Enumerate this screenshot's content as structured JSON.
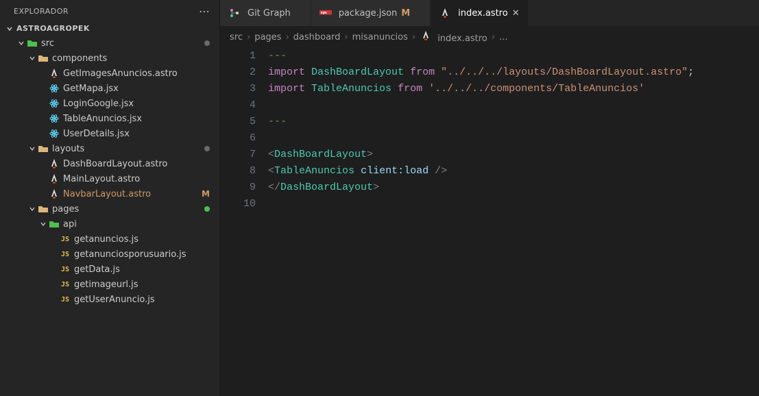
{
  "sidebar": {
    "title": "EXPLORADOR",
    "project": "ASTROAGROPEK",
    "tree": [
      {
        "d": 1,
        "chev": "down",
        "icon": "folder-green",
        "label": "src",
        "dot": "grey"
      },
      {
        "d": 2,
        "chev": "down",
        "icon": "folder",
        "label": "components"
      },
      {
        "d": 3,
        "icon": "astro",
        "label": "GetImagesAnuncios.astro"
      },
      {
        "d": 3,
        "icon": "react",
        "label": "GetMapa.jsx"
      },
      {
        "d": 3,
        "icon": "react",
        "label": "LoginGoogle.jsx"
      },
      {
        "d": 3,
        "icon": "react",
        "label": "TableAnuncios.jsx"
      },
      {
        "d": 3,
        "icon": "react",
        "label": "UserDetails.jsx"
      },
      {
        "d": 2,
        "chev": "down",
        "icon": "folder",
        "label": "layouts",
        "dot": "grey"
      },
      {
        "d": 3,
        "icon": "astro",
        "label": "DashBoardLayout.astro"
      },
      {
        "d": 3,
        "icon": "astro",
        "label": "MainLayout.astro"
      },
      {
        "d": 3,
        "icon": "astro",
        "label": "NavbarLayout.astro",
        "modified": true
      },
      {
        "d": 2,
        "chev": "down",
        "icon": "folder",
        "label": "pages",
        "dot": "green"
      },
      {
        "d": 3,
        "chev": "down",
        "icon": "folder-green",
        "label": "api"
      },
      {
        "d": 4,
        "icon": "js",
        "label": "getanuncios.js"
      },
      {
        "d": 4,
        "icon": "js",
        "label": "getanunciosporusuario.js"
      },
      {
        "d": 4,
        "icon": "js",
        "label": "getData.js"
      },
      {
        "d": 4,
        "icon": "js",
        "label": "getimageurl.js"
      },
      {
        "d": 4,
        "icon": "js",
        "label": "getUserAnuncio.js"
      }
    ]
  },
  "tabs": [
    {
      "icon": "gitgraph",
      "label": "Git Graph"
    },
    {
      "icon": "npm",
      "label": "package.json",
      "status": "M"
    },
    {
      "icon": "astro",
      "label": "index.astro",
      "active": true,
      "close": true
    }
  ],
  "breadcrumbs": [
    {
      "label": "src"
    },
    {
      "label": "pages"
    },
    {
      "label": "dashboard"
    },
    {
      "label": "misanuncios"
    },
    {
      "icon": "astro",
      "label": "index.astro"
    },
    {
      "label": "..."
    }
  ],
  "code": {
    "lines": [
      {
        "n": 1,
        "html": "<span class='fm'>---</span>"
      },
      {
        "n": 2,
        "html": "<span class='k'>import</span> <span class='t'>DashBoardLayout</span> <span class='k'>from</span> <span class='s'>\"../../../layouts/DashBoardLayout.astro\"</span>;"
      },
      {
        "n": 3,
        "html": "<span class='k'>import</span> <span class='t'>TableAnuncios</span> <span class='k'>from</span> <span class='s'>'../../../components/TableAnuncios'</span>"
      },
      {
        "n": 4,
        "html": ""
      },
      {
        "n": 5,
        "html": "<span class='fm'>---</span>"
      },
      {
        "n": 6,
        "html": ""
      },
      {
        "n": 7,
        "html": "<span class='p'>&lt;</span><span class='ptag'>DashBoardLayout</span><span class='p'>&gt;</span>"
      },
      {
        "n": 8,
        "html": "<span class='p'>&lt;</span><span class='ptag'>TableAnuncios</span> <span class='attr'>client:load</span> <span class='p'>/&gt;</span>"
      },
      {
        "n": 9,
        "html": "<span class='p'>&lt;/</span><span class='ptag'>DashBoardLayout</span><span class='p'>&gt;</span>"
      },
      {
        "n": 10,
        "html": ""
      }
    ]
  }
}
